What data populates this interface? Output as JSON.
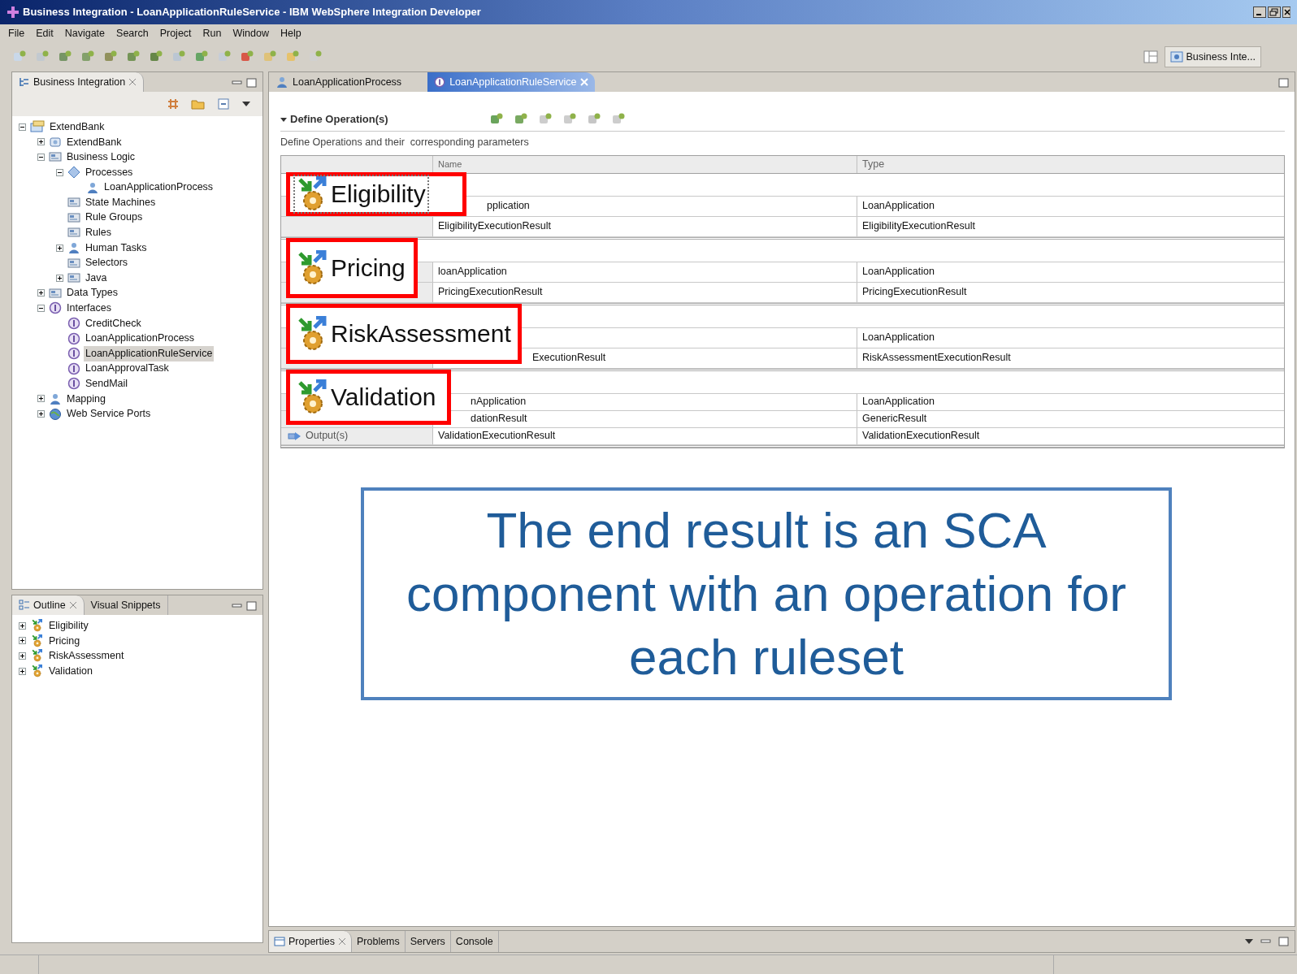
{
  "window": {
    "title": "Business Integration - LoanApplicationRuleService - IBM WebSphere Integration Developer"
  },
  "menu": [
    "File",
    "Edit",
    "Navigate",
    "Search",
    "Project",
    "Run",
    "Window",
    "Help"
  ],
  "perspective": {
    "label": "Business Inte..."
  },
  "explorer": {
    "tab": "Business Integration",
    "tree": [
      {
        "label": "ExtendBank",
        "kind": "project",
        "expanded": true,
        "selected": false,
        "children": [
          {
            "label": "ExtendBank",
            "kind": "module",
            "expanded": false,
            "selected": false
          },
          {
            "label": "Business Logic",
            "kind": "folder",
            "expanded": true,
            "selected": false,
            "children": [
              {
                "label": "Processes",
                "kind": "process",
                "expanded": true,
                "selected": false,
                "children": [
                  {
                    "label": "LoanApplicationProcess",
                    "kind": "person",
                    "selected": false
                  }
                ]
              },
              {
                "label": "State Machines",
                "kind": "folder",
                "selected": false
              },
              {
                "label": "Rule Groups",
                "kind": "folder",
                "selected": false
              },
              {
                "label": "Rules",
                "kind": "folder",
                "selected": false
              },
              {
                "label": "Human Tasks",
                "kind": "person",
                "expanded": false,
                "selected": false
              },
              {
                "label": "Selectors",
                "kind": "folder",
                "selected": false
              },
              {
                "label": "Java",
                "kind": "folder",
                "expanded": false,
                "selected": false
              }
            ]
          },
          {
            "label": "Data Types",
            "kind": "folder",
            "expanded": false,
            "selected": false
          },
          {
            "label": "Interfaces",
            "kind": "interface",
            "expanded": true,
            "selected": false,
            "children": [
              {
                "label": "CreditCheck",
                "kind": "interface",
                "selected": false
              },
              {
                "label": "LoanApplicationProcess",
                "kind": "interface",
                "selected": false
              },
              {
                "label": "LoanApplicationRuleService",
                "kind": "interface",
                "selected": true
              },
              {
                "label": "LoanApprovalTask",
                "kind": "interface",
                "selected": false
              },
              {
                "label": "SendMail",
                "kind": "interface",
                "selected": false
              }
            ]
          },
          {
            "label": "Mapping",
            "kind": "person",
            "expanded": false,
            "selected": false
          },
          {
            "label": "Web Service Ports",
            "kind": "globe",
            "expanded": false,
            "selected": false
          }
        ]
      }
    ]
  },
  "outline": {
    "tabs": [
      {
        "label": "Outline",
        "selected": true
      },
      {
        "label": "Visual Snippets",
        "selected": false
      }
    ],
    "items": [
      {
        "label": "Eligibility",
        "expanded": false
      },
      {
        "label": "Pricing",
        "expanded": false
      },
      {
        "label": "RiskAssessment",
        "expanded": false
      },
      {
        "label": "Validation",
        "expanded": false
      }
    ]
  },
  "editor": {
    "tabs": [
      {
        "label": "LoanApplicationProcess",
        "selected": false
      },
      {
        "label": "LoanApplicationRuleService",
        "selected": true
      }
    ],
    "section": {
      "title": "Define Operation(s)",
      "description": "Define Operations and their  corresponding parameters"
    },
    "columns": [
      "Name",
      "Type"
    ],
    "operations": [
      {
        "name": "Eligibility",
        "selected": true,
        "rows": [
          {
            "name": "pplication",
            "type": "LoanApplication"
          },
          {
            "name": "EligibilityExecutionResult",
            "type": "EligibilityExecutionResult"
          }
        ]
      },
      {
        "name": "Pricing",
        "selected": false,
        "rows": [
          {
            "name": "loanApplication",
            "type": "LoanApplication"
          },
          {
            "name": "PricingExecutionResult",
            "type": "PricingExecutionResult"
          }
        ]
      },
      {
        "name": "RiskAssessment",
        "selected": false,
        "rows": [
          {
            "type": "LoanApplication"
          },
          {
            "name": "ExecutionResult",
            "type": "RiskAssessmentExecutionResult"
          }
        ]
      },
      {
        "name": "Validation",
        "selected": false,
        "rows": [
          {
            "name": "nApplication",
            "type": "LoanApplication"
          },
          {
            "name": "dationResult",
            "type": "GenericResult"
          },
          {
            "label": "Output(s)",
            "name": "ValidationExecutionResult",
            "type": "ValidationExecutionResult"
          }
        ]
      }
    ]
  },
  "note": "The end result is an SCA component with an operation for each ruleset",
  "bottom_tabs": [
    {
      "label": "Properties",
      "selected": true
    },
    {
      "label": "Problems",
      "selected": false
    },
    {
      "label": "Servers",
      "selected": false
    },
    {
      "label": "Console",
      "selected": false
    }
  ]
}
